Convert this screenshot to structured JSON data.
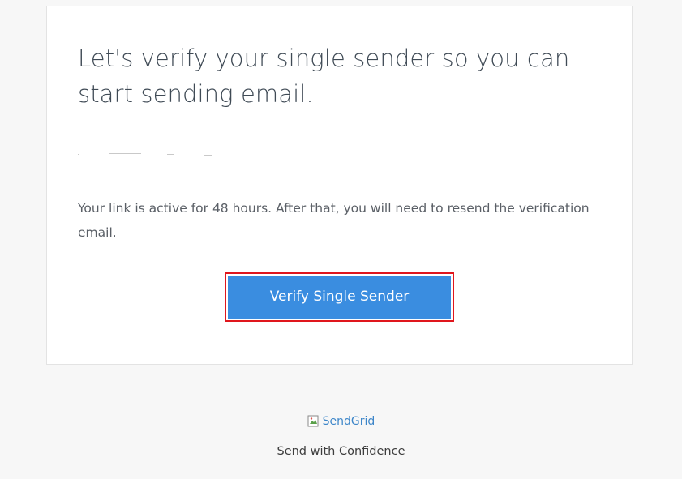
{
  "email": {
    "headline": "Let's verify your single sender so you can start sending email.",
    "body": "Your link is active for 48 hours. After that, you will need to resend the verification email.",
    "cta_label": "Verify Single Sender"
  },
  "footer": {
    "logo_alt": "SendGrid",
    "tagline": "Send with Confidence"
  },
  "colors": {
    "button": "#3a8de0",
    "highlight_border": "#e0161d",
    "link": "#3d86c9"
  }
}
